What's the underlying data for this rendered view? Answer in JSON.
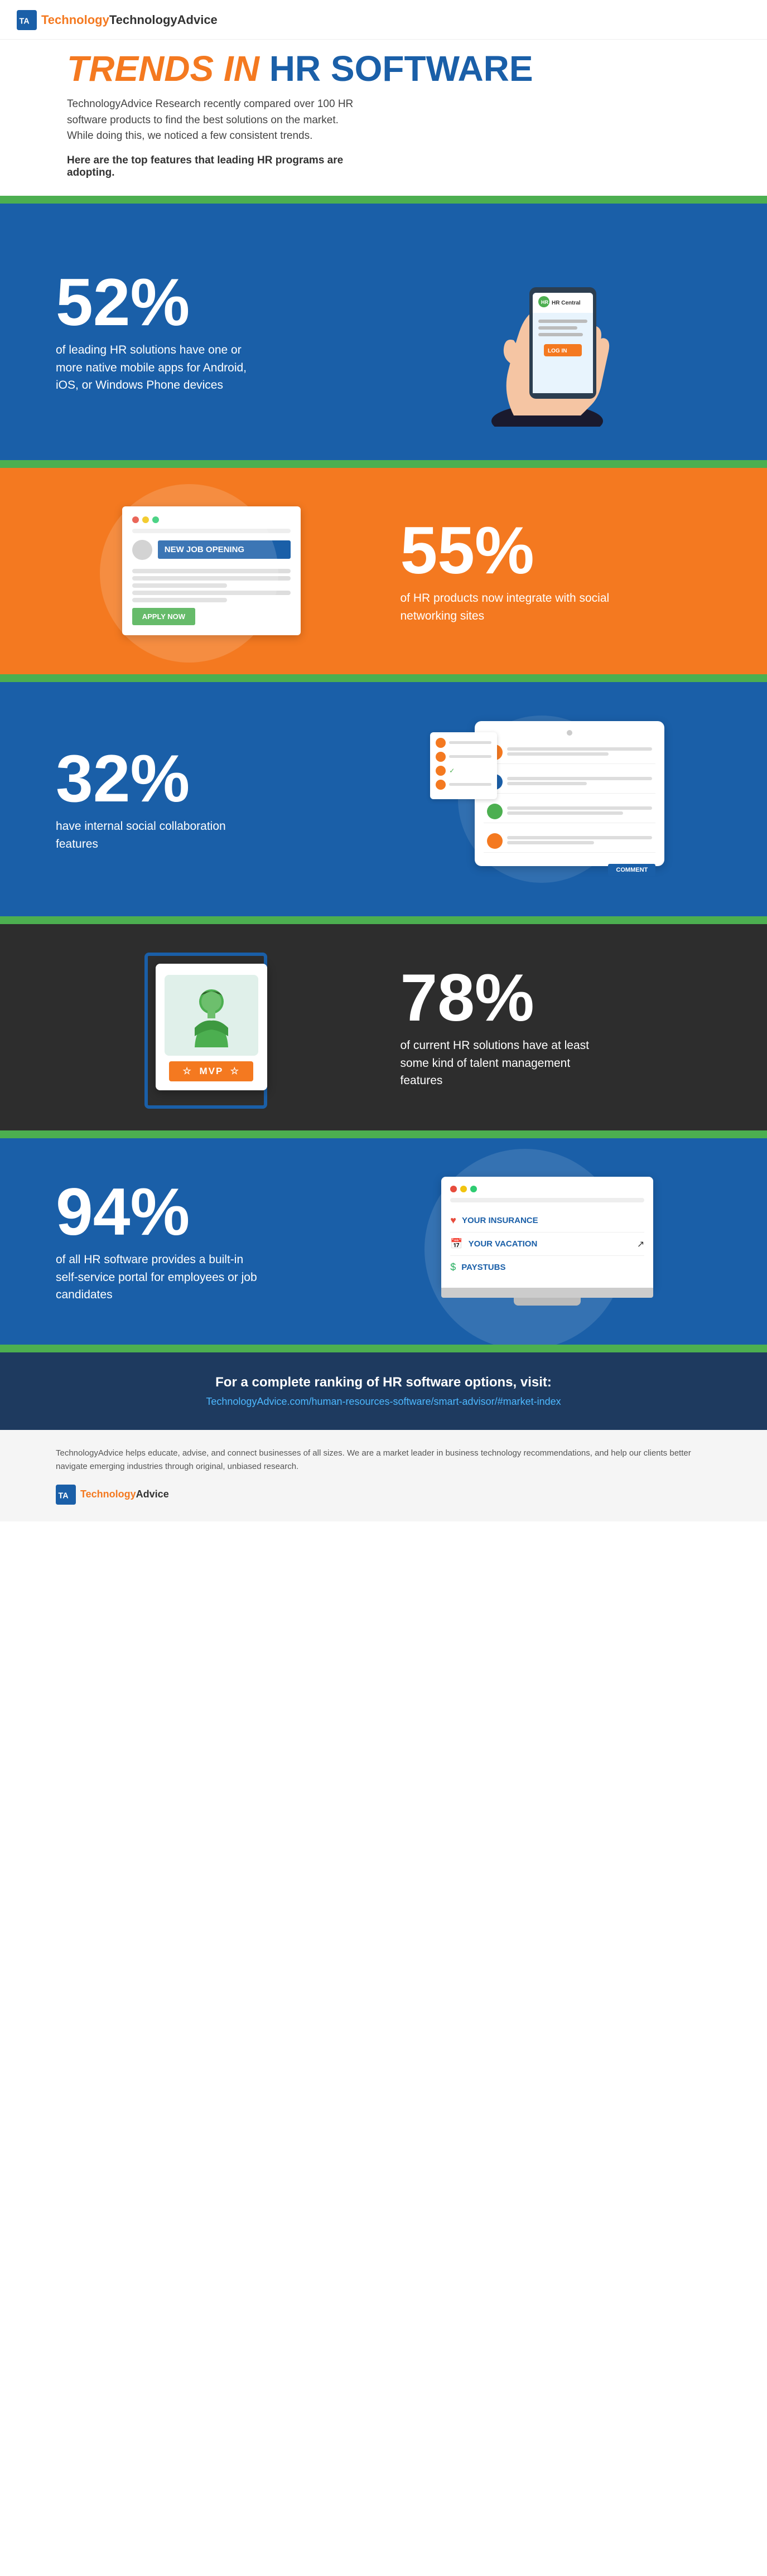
{
  "logo": {
    "icon_text": "TA",
    "brand_name": "TechnologyAdvice"
  },
  "header": {
    "title_italic": "TRENDS IN",
    "title_main": "HR SOFTWARE"
  },
  "intro": {
    "body": "TechnologyAdvice Research recently compared over 100 HR software products to find the best solutions on the market. While doing this, we noticed a few consistent trends.",
    "highlight": "Here are the top features that leading HR programs are adopting."
  },
  "section1": {
    "percent": "52%",
    "description": "of leading HR solutions have one or more native mobile apps for Android, iOS, or Windows Phone devices",
    "phone_label": "HR Central",
    "login_label": "LOG IN"
  },
  "section2": {
    "percent": "55%",
    "description": "of HR products now integrate with social networking sites",
    "job_title": "NEW JOB OPENING",
    "apply_label": "APPLY NOW"
  },
  "section3": {
    "percent": "32%",
    "description": "have internal social collaboration features",
    "comment_label": "COMMENT"
  },
  "section4": {
    "percent": "78%",
    "description": "of current HR solutions have at least some kind of talent management features",
    "mvp_label": "MVP"
  },
  "section5": {
    "percent": "94%",
    "description": "of all HR software provides a built-in self-service portal for employees or job candidates",
    "menu_items": [
      {
        "label": "YOUR INSURANCE",
        "icon": "heart"
      },
      {
        "label": "YOUR VACATION",
        "icon": "calendar"
      },
      {
        "label": "PAYSTUBS",
        "icon": "dollar"
      }
    ]
  },
  "footer_cta": {
    "heading": "For a complete ranking of HR software options, visit:",
    "link": "TechnologyAdvice.com/human-resources-software/smart-advisor/#market-index"
  },
  "footer_about": {
    "text": "TechnologyAdvice helps educate, advise, and connect businesses of all sizes. We are a market leader in business technology recommendations, and help our clients better navigate emerging industries through original, unbiased research."
  },
  "colors": {
    "blue": "#1a5fa8",
    "orange": "#f47920",
    "green": "#4caf50",
    "dark": "#2d2d2d",
    "footer_dark": "#1e3a5f"
  }
}
